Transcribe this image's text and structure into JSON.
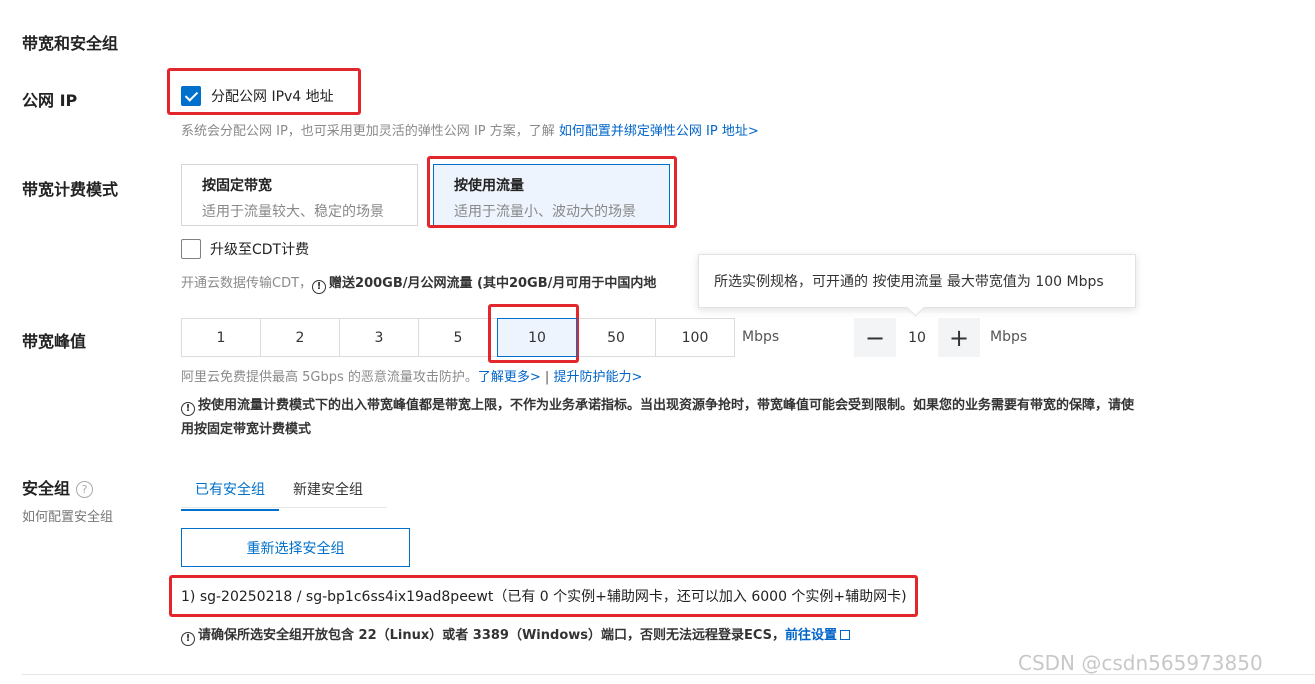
{
  "section": {
    "title": "带宽和安全组"
  },
  "public_ip": {
    "label": "公网 IP",
    "checkbox_label": "分配公网 IPv4 地址",
    "checked": true,
    "hint": "系统会分配公网 IP，也可采用更加灵活的弹性公网 IP 方案，了解",
    "link": "如何配置并绑定弹性公网 IP 地址>"
  },
  "billing": {
    "label": "带宽计费模式",
    "options": [
      {
        "title": "按固定带宽",
        "desc": "适用于流量较大、稳定的场景",
        "selected": false
      },
      {
        "title": "按使用流量",
        "desc": "适用于流量小、波动大的场景",
        "selected": true
      }
    ],
    "cdt_checkbox": "升级至CDT计费",
    "cdt_checked": false,
    "cdt_hint_prefix": "开通云数据传输CDT，",
    "cdt_hint_bold": "赠送200GB/月公网流量 (其中20GB/月可用于中国内地"
  },
  "tooltip": {
    "text": "所选实例规格，可开通的 按使用流量 最大带宽值为 100 Mbps"
  },
  "peak": {
    "label": "带宽峰值",
    "options": [
      "1",
      "2",
      "3",
      "5",
      "10",
      "50",
      "100"
    ],
    "selected": "10",
    "unit": "Mbps",
    "stepper_value": "10",
    "stepper_unit": "Mbps",
    "minus": "−",
    "plus": "+",
    "hint": "阿里云免费提供最高 5Gbps 的恶意流量攻击防护。",
    "link1": "了解更多>",
    "separator": " | ",
    "link2": "提升防护能力>",
    "warning_line1": "按使用流量计费模式下的出入带宽峰值都是带宽上限，不作为业务承诺指标。当出现资源争抢时，带宽峰值可能会受到限制。如果您的业务需要有带宽的保障，请使",
    "warning_line2": "用按固定带宽计费模式"
  },
  "security_group": {
    "label": "安全组",
    "help": "?",
    "sub_link": "如何配置安全组",
    "tabs": [
      {
        "label": "已有安全组",
        "active": true
      },
      {
        "label": "新建安全组",
        "active": false
      }
    ],
    "reselect_button": "重新选择安全组",
    "selected_info": "1) sg-20250218 / sg-bp1c6ss4ix19ad8peewt（已有 0 个实例+辅助网卡，还可以加入 6000 个实例+辅助网卡)",
    "warning": "请确保所选安全组开放包含 22（Linux）或者 3389（Windows）端口，否则无法远程登录ECS，",
    "warning_link": "前往设置"
  },
  "watermark": "CSDN @csdn565973850",
  "colors": {
    "primary": "#0070cc",
    "link": "#0064c8",
    "highlight": "#e3252c",
    "selected_bg": "#eef4fd"
  }
}
